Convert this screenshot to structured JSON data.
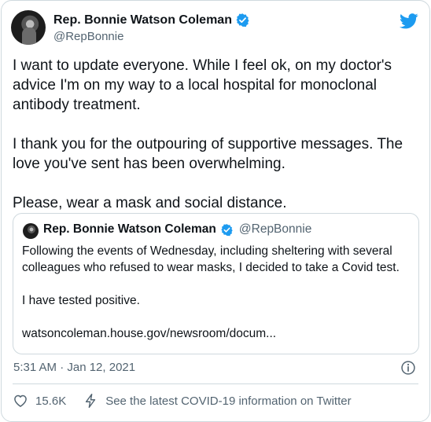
{
  "author": {
    "name": "Rep. Bonnie Watson Coleman",
    "handle": "@RepBonnie"
  },
  "tweet": {
    "paragraphs": [
      "I want to update everyone. While I feel ok, on my doctor's advice I'm on my way to a local hospital for monoclonal antibody treatment.",
      "I thank you for the outpouring of supportive messages. The love you've sent has been overwhelming.",
      "Please, wear a mask and social distance."
    ],
    "timestamp": "5:31 AM · Jan 12, 2021"
  },
  "quoted_tweet": {
    "name": "Rep. Bonnie Watson Coleman",
    "handle": "@RepBonnie",
    "paragraphs": [
      "Following the events of Wednesday, including sheltering with several colleagues who refused to wear masks, I decided to take a Covid test.",
      "I have tested positive.",
      "watsoncoleman.house.gov/newsroom/docum..."
    ]
  },
  "actions": {
    "like_count": "15.6K",
    "covid_info": "See the latest COVID-19 information on Twitter"
  },
  "colors": {
    "verified": "#1d9bf0",
    "twitter_blue": "#1d9bf0",
    "secondary_text": "#536471",
    "border": "#cfd9de"
  },
  "icons": [
    "verified-badge-icon",
    "twitter-bird-icon",
    "info-icon",
    "heart-icon",
    "lightning-bolt-icon"
  ]
}
